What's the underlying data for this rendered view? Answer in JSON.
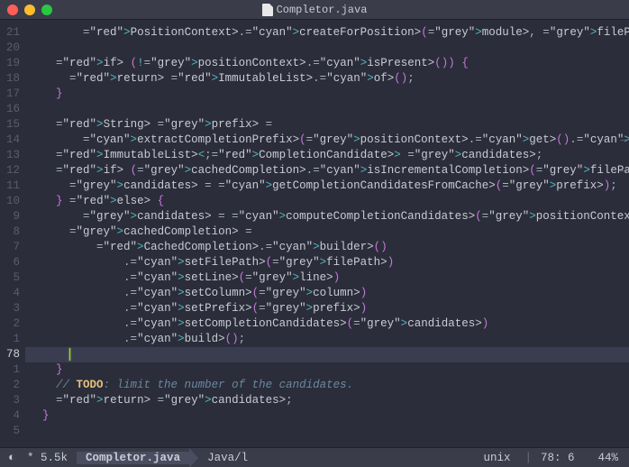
{
  "window": {
    "title": "Completor.java"
  },
  "gutter": {
    "numbers": [
      "21",
      "20",
      "19",
      "18",
      "17",
      "16",
      "15",
      "14",
      "13",
      "12",
      "11",
      "10",
      "9",
      "8",
      "7",
      "6",
      "5",
      "4",
      "3",
      "2",
      "1",
      "78",
      "1",
      "2",
      "3",
      "4",
      "5"
    ],
    "current_index": 21
  },
  "code": {
    "l0": "        PositionContext.createForPosition(module, filePath, line, contextColumn);",
    "l1": "",
    "l2": "    if (!positionContext.isPresent()) {",
    "l3": "      return ImmutableList.of();",
    "l4": "    }",
    "l5": "",
    "l6": "    String prefix =",
    "l7": "        extractCompletionPrefix(positionContext.get().getFileScope(), filePath, li",
    "l7_overflow": "→",
    "l8": "    ImmutableList<CompletionCandidate> candidates;",
    "l9": "    if (cachedCompletion.isIncrementalCompletion(filePath, line, column, prefix)) ",
    "l9_overflow": "→",
    "l10": "      candidates = getCompletionCandidatesFromCache(prefix);",
    "l11": "    } else {",
    "l12": "        candidates = computeCompletionCandidates(positionContext.get(), prefix);",
    "l13": "      cachedCompletion =",
    "l14": "          CachedCompletion.builder()",
    "l15": "              .setFilePath(filePath)",
    "l16": "              .setLine(line)",
    "l17": "              .setColumn(column)",
    "l18": "              .setPrefix(prefix)",
    "l19": "              .setCompletionCandidates(candidates)",
    "l20": "              .build();",
    "l21": "      ",
    "l22": "    }",
    "l23": "    // TODO: limit the number of the candidates.",
    "l24": "    return candidates;",
    "l25": "  }",
    "l26": ""
  },
  "status": {
    "modified": "*",
    "filesize": "5.5k",
    "filename": "Completor.java",
    "language": "Java/l",
    "encoding": "unix",
    "position": "78: 6",
    "percent": "44%"
  },
  "colors": {
    "bg": "#2b2d3a",
    "fg": "#c8ccd4",
    "red": "#e06c75",
    "green": "#98c379",
    "cyan": "#56b6c2",
    "blue": "#61afef",
    "yellow": "#e5c07b",
    "magenta": "#c678dd"
  }
}
